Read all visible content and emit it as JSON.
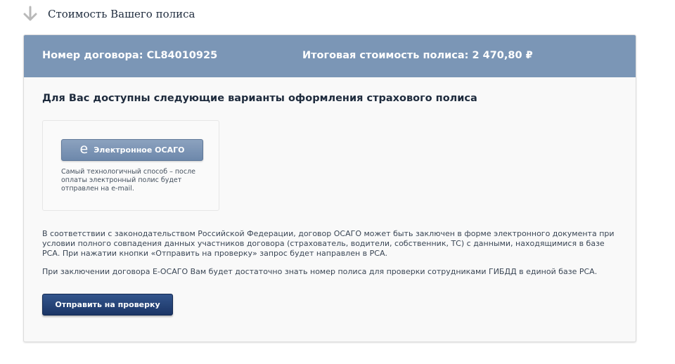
{
  "section": {
    "title": "Стоимость Вашего полиса",
    "icon": "arrow-down-icon"
  },
  "header": {
    "contract": "Номер договора: CL84010925",
    "total": "Итоговая стоимость полиса: 2 470,80 ₽"
  },
  "options": {
    "title": "Для Вас доступны следующие варианты оформления страхового полиса",
    "eosago": {
      "icon_glyph": "e",
      "label": "Электронное ОСАГО",
      "description": "Самый технологичный способ – после оплаты электронный полис будет отправлен на e-mail."
    }
  },
  "legal": {
    "paragraph1": "В соответствии с законодательством Российской Федерации, договор ОСАГО может быть заключен в форме электронного документа при условии полного совпадения данных участников договора (страхователь, водители, собственник, ТС) с данными, находящимися в базе РСА. При нажатии кнопки «Отправить на проверку» запрос будет направлен в РСА.",
    "paragraph2": "При заключении договора Е-ОСАГО Вам будет достаточно знать номер полиса для проверки сотрудниками ГИБДД в единой базе РСА."
  },
  "submit": {
    "label": "Отправить на проверку"
  },
  "colors": {
    "header_bg": "#7b96b6",
    "submit_bg": "#1f3a6d",
    "eosago_bg": "#7d95b6"
  }
}
